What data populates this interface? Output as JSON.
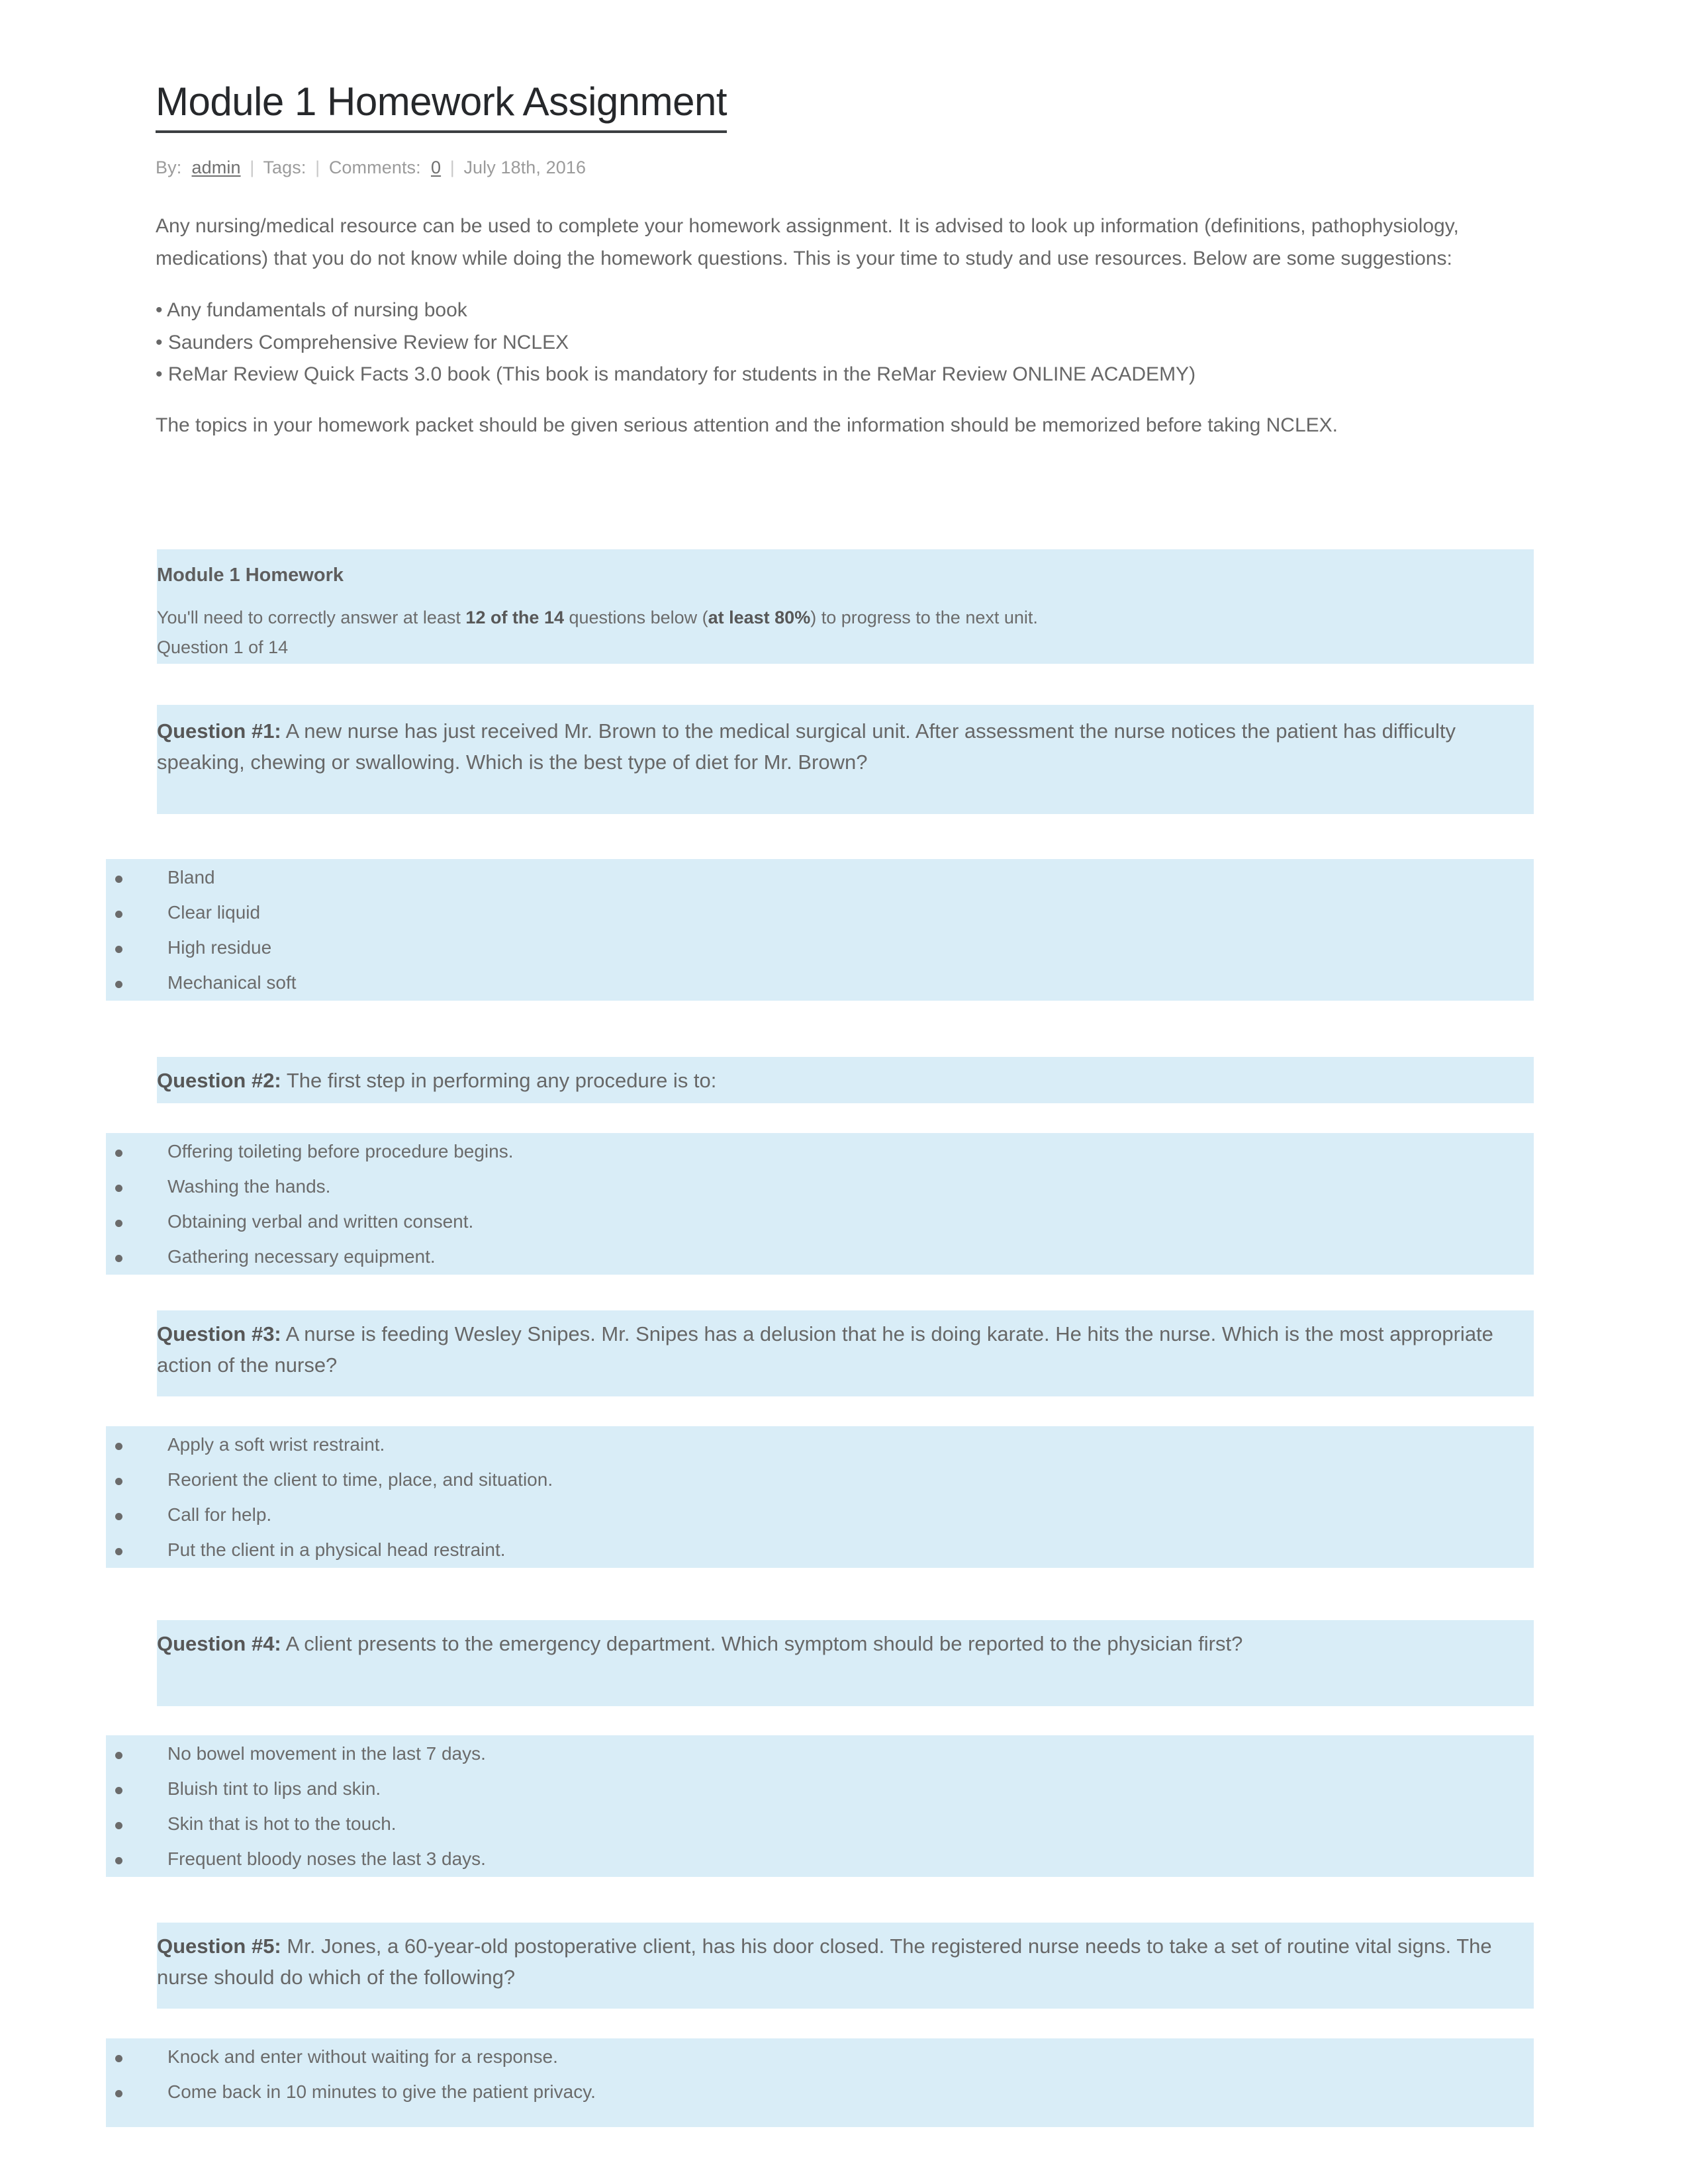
{
  "document": {
    "title": "Module 1 Homework Assignment",
    "byline": {
      "by_label": "By:",
      "author": "admin",
      "tags_label": "Tags:",
      "comments_label": "Comments:",
      "comments_count": "0",
      "date": "July 18th, 2016",
      "separator": "|"
    },
    "intro": {
      "paragraph_1": "Any nursing/medical resource can be used to complete your homework assignment. It is advised to look up information (definitions, pathophysiology, medications) that you do not know while doing the homework questions. This is your time to study and use resources. Below are some suggestions:",
      "suggestions": [
        "• Any fundamentals of nursing book",
        "• Saunders Comprehensive Review for NCLEX",
        "• ReMar Review Quick Facts 3.0 book (This book is mandatory for students in the ReMar Review ONLINE ACADEMY)"
      ],
      "paragraph_2": "The topics in your homework packet should be given serious attention and the information should be memorized before taking NCLEX."
    },
    "homework_box": {
      "heading": "Module 1 Homework",
      "requirement_pre": "You'll need to correctly answer at least ",
      "requirement_bold_1": "12 of the 14",
      "requirement_mid": " questions below (",
      "requirement_bold_2": "at least 80%",
      "requirement_post": ") to progress to the next unit.",
      "question_counter": "Question 1 of 14"
    },
    "questions": [
      {
        "label": "Question #1:",
        "text": " A new nurse has just received Mr. Brown to the medical surgical unit. After assessment the nurse notices the patient has difficulty speaking, chewing or swallowing. Which is the best type of diet for Mr. Brown?",
        "options": [
          "Bland",
          "Clear liquid",
          "High residue",
          "Mechanical soft"
        ]
      },
      {
        "label": "Question #2:",
        "text": " The first step in performing any procedure is to:",
        "options": [
          "Offering toileting before procedure begins.",
          "Washing the hands.",
          "Obtaining verbal and written consent.",
          "Gathering necessary equipment."
        ]
      },
      {
        "label": "Question #3:",
        "text": " A nurse is feeding Wesley Snipes. Mr. Snipes has a delusion that he is doing karate. He hits the nurse. Which is the most appropriate action of the nurse?",
        "options": [
          "Apply a soft wrist restraint.",
          "Reorient the client to time, place, and situation.",
          "Call for help.",
          "Put the client in a physical head restraint."
        ]
      },
      {
        "label": "Question #4:",
        "text": " A client presents to the emergency department. Which symptom should be reported to the physician first?",
        "options": [
          "No bowel movement in the last 7 days.",
          "Bluish tint to lips and skin.",
          "Skin that is hot to the touch.",
          "Frequent bloody noses the last 3 days."
        ]
      },
      {
        "label": "Question #5:",
        "text": " Mr. Jones, a 60-year-old postoperative client, has his door closed. The registered nurse needs to take a set of routine vital signs. The nurse should do which of the following?",
        "options": [
          "Knock and enter without waiting for a response.",
          "Come back in 10 minutes to give the patient privacy."
        ]
      }
    ],
    "colors": {
      "highlight_background": "#d9edf7",
      "body_text": "#676767",
      "title_text": "#26282b",
      "byline_text": "#9b9b9b"
    }
  }
}
